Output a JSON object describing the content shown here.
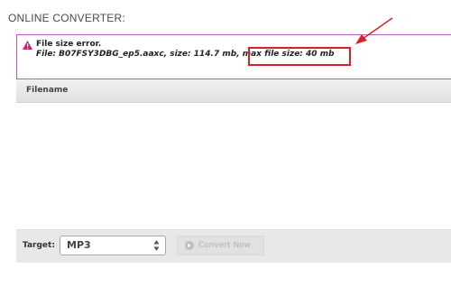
{
  "section": {
    "title": "ONLINE CONVERTER:"
  },
  "error": {
    "title": "File size error.",
    "detail_prefix": "File: B07FSY3DBG_ep5.aaxc, size: 114.7 mb",
    "detail_separator": ",",
    "detail_highlight": " max file size: 40 mb",
    "icon": "warning-icon",
    "border_color": "#b35bb8"
  },
  "annotation": {
    "color": "#d6202b",
    "icon": "red-arrow"
  },
  "file_table": {
    "header": "Filename",
    "rows": []
  },
  "toolbar": {
    "target_label": "Target:",
    "target_value": "MP3",
    "convert_label": "Convert Now",
    "convert_icon": "convert-icon"
  }
}
